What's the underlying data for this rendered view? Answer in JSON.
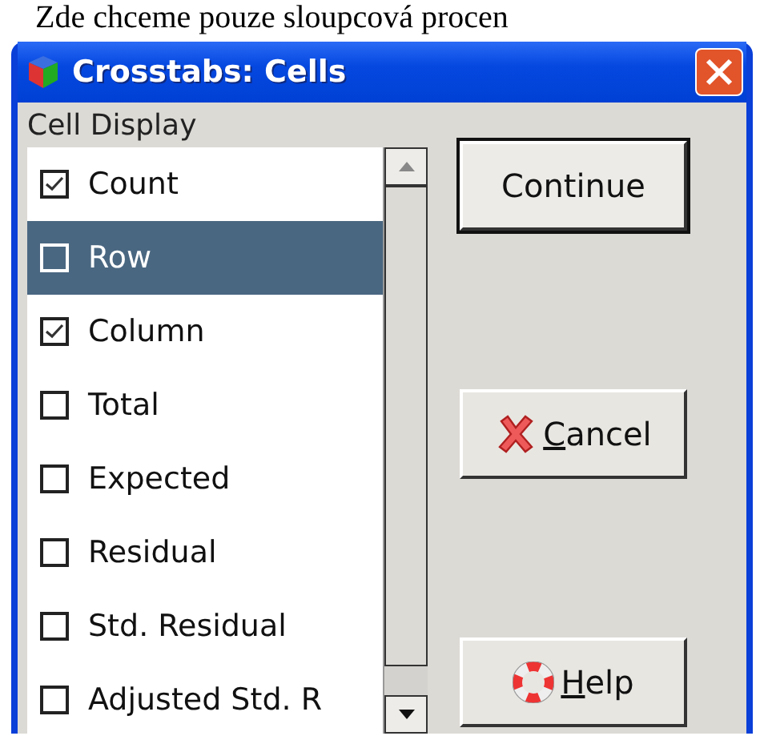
{
  "document_text": "Zde chceme pouze sloupcová procen",
  "window": {
    "title": "Crosstabs: Cells"
  },
  "group_label": "Cell Display",
  "items": [
    {
      "label": "Count",
      "checked": true,
      "selected": false
    },
    {
      "label": "Row",
      "checked": false,
      "selected": true
    },
    {
      "label": "Column",
      "checked": true,
      "selected": false
    },
    {
      "label": "Total",
      "checked": false,
      "selected": false
    },
    {
      "label": "Expected",
      "checked": false,
      "selected": false
    },
    {
      "label": "Residual",
      "checked": false,
      "selected": false
    },
    {
      "label": "Std. Residual",
      "checked": false,
      "selected": false
    },
    {
      "label": "Adjusted Std. R",
      "checked": false,
      "selected": false
    }
  ],
  "buttons": [
    {
      "kind": "default",
      "label": "Continue",
      "mnemonic": false
    },
    {
      "kind": "cancel",
      "label": "Cancel",
      "mnemonic": true
    },
    {
      "kind": "help",
      "label": "Help",
      "mnemonic": true
    }
  ]
}
